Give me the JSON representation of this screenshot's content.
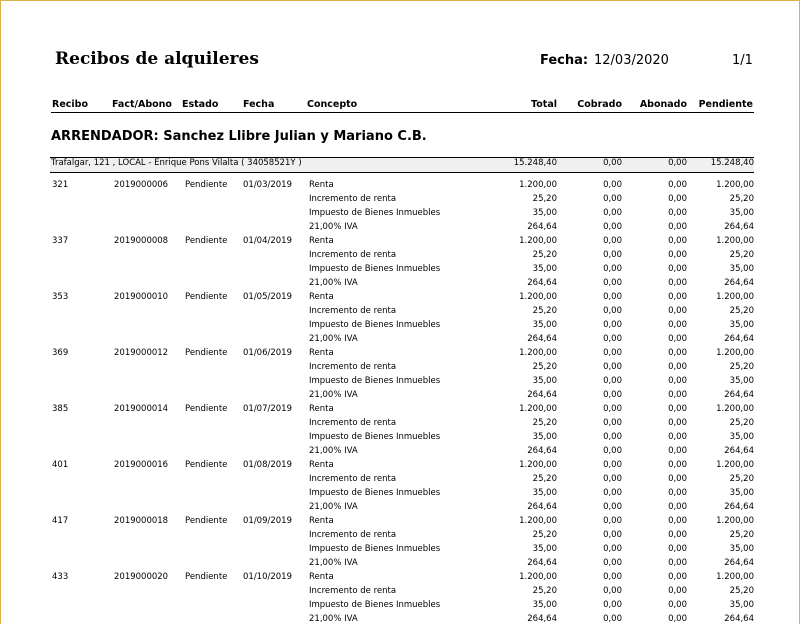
{
  "report": {
    "title": "Recibos de alquileres",
    "fecha_label": "Fecha:",
    "fecha_value": "12/03/2020",
    "page": "1/1"
  },
  "columns": {
    "recibo": "Recibo",
    "fact": "Fact/Abono",
    "estado": "Estado",
    "fecha": "Fecha",
    "concepto": "Concepto",
    "total": "Total",
    "cobrado": "Cobrado",
    "abonado": "Abonado",
    "pendiente": "Pendiente"
  },
  "arrendador": "ARRENDADOR: Sanchez Llibre Julian y Mariano C.B.",
  "property": {
    "label": "Trafalgar, 121 , LOCAL - Enrique Pons Vilalta ( 34058521Y )",
    "total": "15.248,40",
    "cobrado": "0,00",
    "abonado": "0,00",
    "pendiente": "15.248,40"
  },
  "receipts": [
    {
      "recibo": "321",
      "fact": "2019000006",
      "estado": "Pendiente",
      "fecha": "01/03/2019"
    },
    {
      "recibo": "337",
      "fact": "2019000008",
      "estado": "Pendiente",
      "fecha": "01/04/2019"
    },
    {
      "recibo": "353",
      "fact": "2019000010",
      "estado": "Pendiente",
      "fecha": "01/05/2019"
    },
    {
      "recibo": "369",
      "fact": "2019000012",
      "estado": "Pendiente",
      "fecha": "01/06/2019"
    },
    {
      "recibo": "385",
      "fact": "2019000014",
      "estado": "Pendiente",
      "fecha": "01/07/2019"
    },
    {
      "recibo": "401",
      "fact": "2019000016",
      "estado": "Pendiente",
      "fecha": "01/08/2019"
    },
    {
      "recibo": "417",
      "fact": "2019000018",
      "estado": "Pendiente",
      "fecha": "01/09/2019"
    },
    {
      "recibo": "433",
      "fact": "2019000020",
      "estado": "Pendiente",
      "fecha": "01/10/2019"
    }
  ],
  "concept_lines": [
    {
      "concepto": "Renta",
      "total": "1.200,00",
      "cobrado": "0,00",
      "abonado": "0,00",
      "pendiente": "1.200,00"
    },
    {
      "concepto": "Incremento de renta",
      "total": "25,20",
      "cobrado": "0,00",
      "abonado": "0,00",
      "pendiente": "25,20"
    },
    {
      "concepto": "Impuesto de Bienes Inmuebles",
      "total": "35,00",
      "cobrado": "0,00",
      "abonado": "0,00",
      "pendiente": "35,00"
    },
    {
      "concepto": "21,00% IVA",
      "total": "264,64",
      "cobrado": "0,00",
      "abonado": "0,00",
      "pendiente": "264,64"
    }
  ]
}
